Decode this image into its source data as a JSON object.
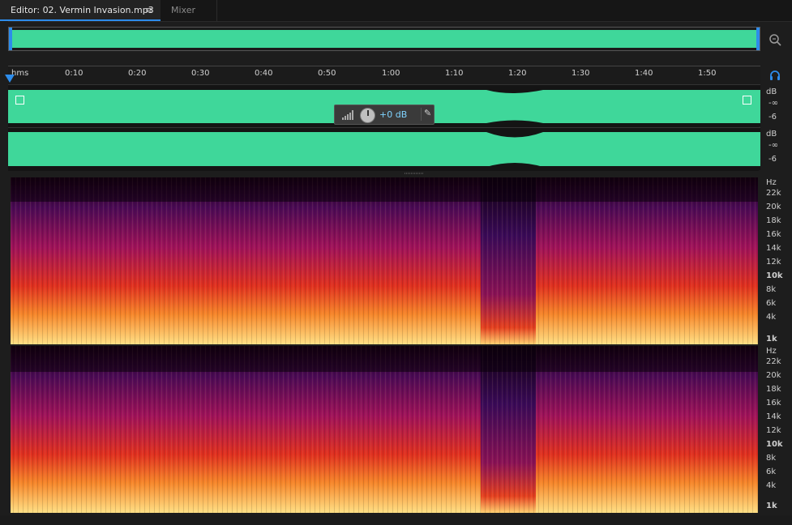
{
  "tabs": {
    "editor_label": "Editor: 02. Vermin Invasion.mp3",
    "editor_menu": "≡",
    "mixer_label": "Mixer"
  },
  "ruler": {
    "format_label": "hms",
    "ticks": [
      "0:10",
      "0:20",
      "0:30",
      "0:40",
      "0:50",
      "1:00",
      "1:10",
      "1:20",
      "1:30",
      "1:40",
      "1:50"
    ]
  },
  "hud": {
    "gain_value": "+0 dB"
  },
  "amplitude_scale": {
    "unit": "dB",
    "labels": [
      "-∞",
      "-6"
    ]
  },
  "frequency_scale": {
    "unit": "Hz",
    "labels": [
      "22k",
      "20k",
      "18k",
      "16k",
      "14k",
      "12k",
      "10k",
      "8k",
      "6k",
      "4k",
      "1k"
    ]
  },
  "colors": {
    "waveform": "#3fd79a",
    "accent": "#2d8ceb",
    "spectrum_low": "#1a0014",
    "spectrum_mid": "#a0125a",
    "spectrum_high": "#f0561a",
    "spectrum_peak": "#ffe085"
  },
  "icons": {
    "zoom": "zoom-icon",
    "headphones": "headphones-icon",
    "pin": "pin-icon"
  }
}
